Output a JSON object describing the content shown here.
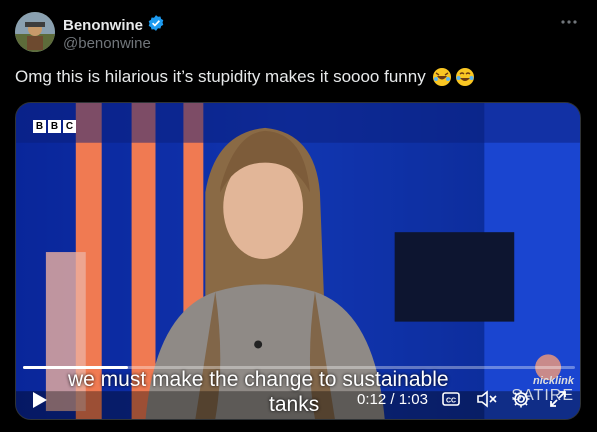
{
  "post": {
    "display_name": "Benonwine",
    "handle": "@benonwine",
    "verified": true,
    "text": "Omg this is hilarious it’s stupidity makes it soooo funny",
    "emojis": [
      "rolling-on-floor-laughing-emoji",
      "tears-of-joy-emoji"
    ]
  },
  "video": {
    "channel_logo": [
      "B",
      "B",
      "C"
    ],
    "subtitle_line1": "we must make the change to sustainable",
    "subtitle_line2": "tanks",
    "watermark_top": "nicklink",
    "watermark_bottom": "SATIRE",
    "current_time": "0:12",
    "separator": "/",
    "duration": "1:03",
    "progress_fraction": 0.19,
    "time_display": "0:12 / 1:03"
  },
  "icons": {
    "more": "more-options-icon",
    "verified": "verified-badge-icon",
    "play": "play-icon",
    "captions": "captions-icon",
    "mute": "muted-volume-icon",
    "settings": "settings-gear-icon",
    "fullscreen": "fullscreen-icon"
  },
  "colors": {
    "verified": "#1d9bf0",
    "background": "#000000",
    "studio_blue": "#1432b4"
  }
}
